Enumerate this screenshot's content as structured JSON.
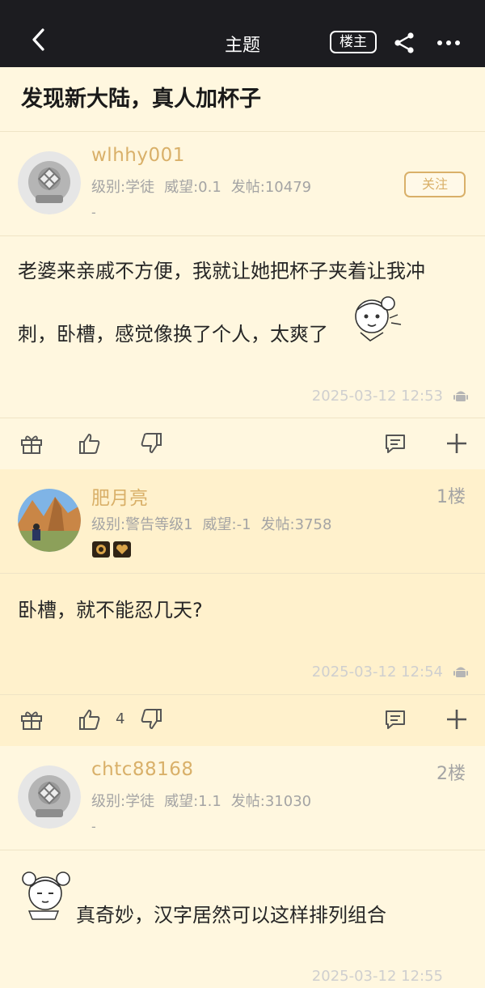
{
  "header": {
    "title": "主题",
    "owner_label": "楼主"
  },
  "thread": {
    "title": "发现新大陆，真人加杯子"
  },
  "posts": [
    {
      "username": "wlhhy001",
      "level": "级别:学徒",
      "prestige": "威望:0.1",
      "posts": "发帖:10479",
      "dash": "-",
      "follow_label": "关注",
      "content_line1": "老婆来亲戚不方便，我就让她把杯子夹着让我冲",
      "content_line2": "刺，卧槽，感觉像换了个人，太爽了",
      "timestamp": "2025-03-12 12:53"
    },
    {
      "username": "肥月亮",
      "floor": "1楼",
      "level": "级别:警告等级1",
      "prestige": "威望:-1",
      "posts": "发帖:3758",
      "content": "卧槽，就不能忍几天?",
      "timestamp": "2025-03-12 12:54",
      "likes": "4"
    },
    {
      "username": "chtc88168",
      "floor": "2楼",
      "level": "级别:学徒",
      "prestige": "威望:1.1",
      "posts": "发帖:31030",
      "dash": "-",
      "content": "真奇妙，汉字居然可以这样排列组合",
      "timestamp": "2025-03-12 12:55"
    }
  ],
  "icons": {
    "back": "chevron-left-icon",
    "share": "share-icon",
    "more": "more-icon",
    "gift": "gift-icon",
    "like": "thumbs-up-icon",
    "dislike": "thumbs-down-icon",
    "comment": "comment-icon",
    "add": "plus-icon",
    "android": "android-icon"
  },
  "colors": {
    "topbar": "#1c1c20",
    "accent": "#d9b069",
    "background": "#fff7df",
    "highlight": "#fff1cc"
  }
}
